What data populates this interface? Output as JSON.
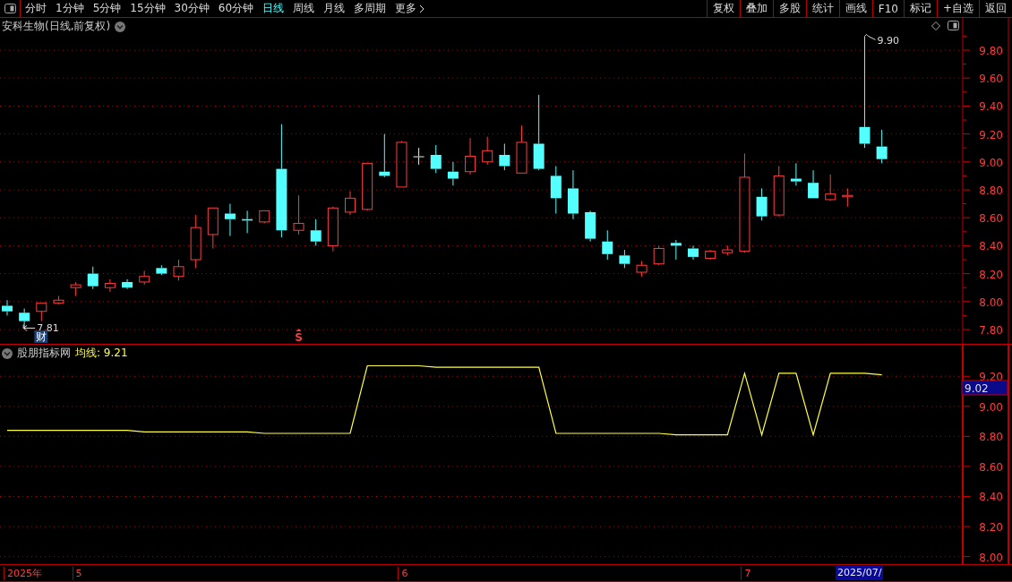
{
  "toolbar": {
    "periods": [
      {
        "label": "分时",
        "selected": false
      },
      {
        "label": "1分钟",
        "selected": false
      },
      {
        "label": "5分钟",
        "selected": false
      },
      {
        "label": "15分钟",
        "selected": false
      },
      {
        "label": "30分钟",
        "selected": false
      },
      {
        "label": "60分钟",
        "selected": false
      },
      {
        "label": "日线",
        "selected": true
      },
      {
        "label": "周线",
        "selected": false
      },
      {
        "label": "月线",
        "selected": false
      },
      {
        "label": "多周期",
        "selected": false
      },
      {
        "label": "更多",
        "selected": false
      }
    ],
    "buttons": [
      "复权",
      "叠加",
      "多股",
      "统计",
      "画线",
      "F10",
      "标记",
      "+自选",
      "返回"
    ]
  },
  "main_pane": {
    "title": "安科生物(日线,前复权)",
    "price_axis": [
      "9.80",
      "9.60",
      "9.40",
      "9.20",
      "9.00",
      "8.80",
      "8.60",
      "8.40",
      "8.20",
      "8.00",
      "7.80"
    ],
    "high_label": "9.90",
    "low_label": "7.81",
    "event_badge": "财",
    "signal_marker": "S"
  },
  "indicator_pane": {
    "name": "股朋指标网",
    "legend": "均线: 9.21",
    "cursor_value": "9.02",
    "chart_data": {
      "type": "line",
      "ylim": [
        7.95,
        9.41
      ],
      "grid": true,
      "yticks": [
        {
          "value": 9.2,
          "label": "9.20"
        },
        {
          "value": 9.0,
          "label": "9.00"
        },
        {
          "value": 8.8,
          "label": "8.80"
        },
        {
          "value": 8.6,
          "label": "8.60"
        },
        {
          "value": 8.4,
          "label": "8.40"
        },
        {
          "value": 8.2,
          "label": "8.20"
        },
        {
          "value": 8.0,
          "label": "8.00"
        }
      ],
      "values": [
        8.84,
        8.84,
        8.84,
        8.84,
        8.84,
        8.84,
        8.84,
        8.84,
        8.83,
        8.83,
        8.83,
        8.83,
        8.83,
        8.83,
        8.83,
        8.82,
        8.82,
        8.82,
        8.82,
        8.82,
        8.82,
        9.27,
        9.27,
        9.27,
        9.27,
        9.26,
        9.26,
        9.26,
        9.26,
        9.26,
        9.26,
        9.26,
        8.82,
        8.82,
        8.82,
        8.82,
        8.82,
        8.82,
        8.82,
        8.81,
        8.81,
        8.81,
        8.81,
        9.22,
        8.81,
        9.22,
        9.22,
        8.81,
        9.22,
        9.22,
        9.22,
        9.21
      ]
    }
  },
  "time_axis": {
    "labels": [
      "2025年",
      "5",
      "6",
      "7"
    ],
    "cursor_date": "2025/07/"
  }
}
